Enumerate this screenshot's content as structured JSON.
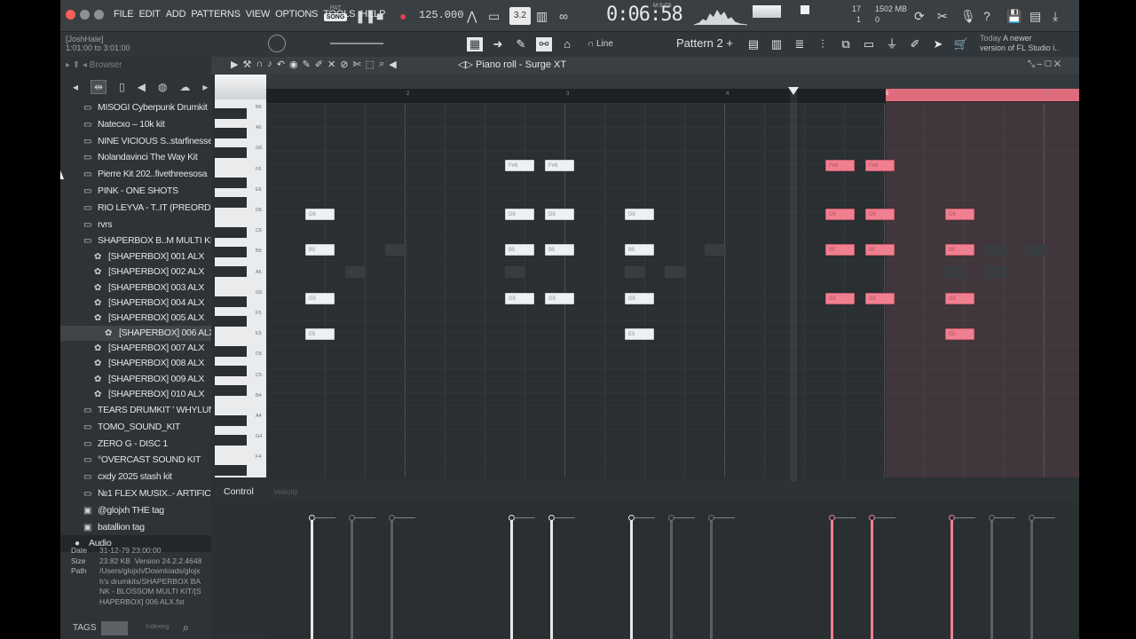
{
  "menus": [
    "FILE",
    "EDIT",
    "ADD",
    "PATTERNS",
    "VIEW",
    "OPTIONS",
    "TOOLS",
    "HELP"
  ],
  "transport": {
    "pat_label": "PAT",
    "song_label": "SONG",
    "tempo": "125.000",
    "time": "0:06:58",
    "time_unit": "M:S:CS"
  },
  "status": {
    "cpu": "17",
    "cpu2": "1",
    "memory": "1502 MB",
    "memory2": "0"
  },
  "hint": {
    "user": "[JoshHale]",
    "range": "1:01:00 to 3:01:00"
  },
  "toolbar2": {
    "snap": "Line",
    "pattern": "Pattern 2",
    "news_date": "Today",
    "news_text": "A newer",
    "news_text2": "version of FL Studio i.."
  },
  "browser": {
    "title": "Browser",
    "items": [
      {
        "label": "MISOGI Cyberpunk Drumkit",
        "type": "folder"
      },
      {
        "label": "Natecxo – 10k kit",
        "type": "folder"
      },
      {
        "label": "NINE VICIOUS S..starfinesse_",
        "type": "folder"
      },
      {
        "label": "Nolandavinci The Way Kit",
        "type": "folder"
      },
      {
        "label": "Pierre Kit 202..fivethreesosa",
        "type": "folder"
      },
      {
        "label": "PINK - ONE SHOTS",
        "type": "folder"
      },
      {
        "label": "RIO LEYVA - T..IT (PREORDER)",
        "type": "folder"
      },
      {
        "label": "rvrs",
        "type": "folder"
      },
      {
        "label": "SHAPERBOX B..M MULTI KIT",
        "type": "folder-open"
      }
    ],
    "subitems": [
      "[SHAPERBOX] 001 ALX",
      "[SHAPERBOX] 002 ALX",
      "[SHAPERBOX] 003 ALX",
      "[SHAPERBOX] 004 ALX",
      "[SHAPERBOX] 005 ALX",
      "[SHAPERBOX] 006 ALX",
      "[SHAPERBOX] 007 ALX",
      "[SHAPERBOX] 008 ALX",
      "[SHAPERBOX] 009 ALX",
      "[SHAPERBOX] 010 ALX"
    ],
    "items2": [
      "TEARS DRUMKIT ' WHYLUNAR",
      "TOMO_SOUND_KIT",
      "ZERO G - DISC 1",
      "°OVERCAST SOUND KIT",
      "cxdy 2025 stash kit",
      "№1 FLEX MUSIX..- ARTIFICIAL"
    ],
    "flp_items": [
      "@glojxh THE tag",
      "batallion tag"
    ],
    "audio_label": "Audio",
    "info": {
      "date_label": "Date",
      "date": "31-12-79 23:00:00",
      "size_label": "Size",
      "size": "23.82 KB",
      "version": "Version 24.2.2.4648",
      "path_label": "Path",
      "path": "/Users/glojxh/Downloads/glojxh's drumkits/SHAPERBOX BANK - BLOSSOM MULTI KIT/[SHAPERBOX] 006 ALX.fst"
    },
    "tags_label": "TAGS",
    "indexing": "Indexing"
  },
  "piano_roll": {
    "title": "Piano roll - Surge XT",
    "control_label": "Control",
    "velocity_label": "Velocity",
    "bar_labels": [
      "2",
      "3",
      "4",
      "5",
      "6"
    ],
    "key_labels": [
      "B6",
      "A6",
      "G6",
      "F6",
      "E6",
      "D6",
      "C6",
      "B5",
      "A5",
      "G5",
      "F5",
      "E5",
      "D5",
      "C5",
      "B4",
      "A4",
      "G4",
      "F4"
    ],
    "notes": [
      {
        "name": "F#6",
        "col": 0,
        "len": 0,
        "row": "F#6"
      }
    ]
  }
}
